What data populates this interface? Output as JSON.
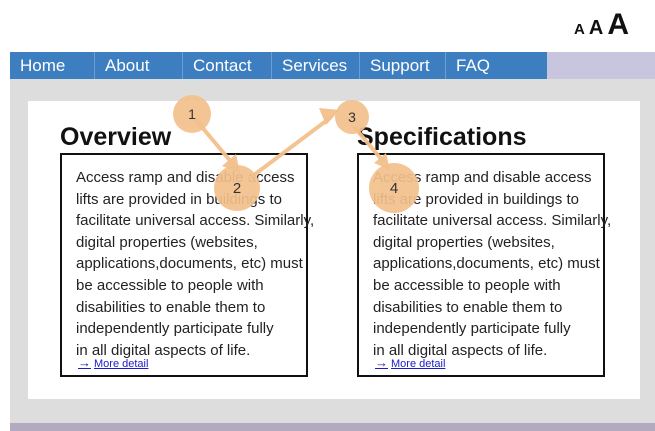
{
  "font_controls": {
    "small": "A",
    "medium": "A",
    "large": "A"
  },
  "nav": {
    "items": [
      "Home",
      "About",
      "Contact",
      "Services",
      "Support",
      "FAQ"
    ]
  },
  "sections": [
    {
      "title": "Overview",
      "body": "Access ramp and disable access\nlifts are provided in buildings to\nfacilitate universal access. Similarly,\ndigital properties (websites,\napplications,documents, etc) must\nbe accessible to people with\ndisabilities to enable them to\nindependently participate fully\nin all digital aspects of life.",
      "link": "More detail",
      "link_arrow": "→"
    },
    {
      "title": "Specifications",
      "body": "Access ramp and disable access\nlifts are provided in buildings to\nfacilitate universal access. Similarly,\ndigital properties (websites,\napplications,documents, etc) must\nbe accessible to people with\ndisabilities to enable them to\nindependently participate fully\nin all digital aspects of life.",
      "link": "More detail",
      "link_arrow": "→"
    }
  ],
  "steps": [
    "1",
    "2",
    "3",
    "4"
  ],
  "colors": {
    "nav": "#3d7ec0",
    "nav_end": "#c8c6de",
    "badge": "#f3c08c",
    "page_bg": "#dddddd",
    "link": "#1a1acc"
  }
}
